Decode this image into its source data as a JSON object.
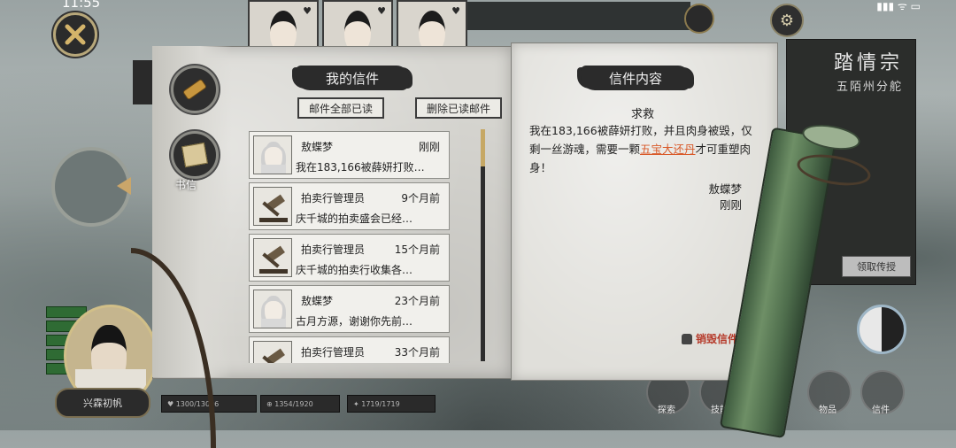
{
  "status_bar": {
    "time": "11:55",
    "right_indicators": "▮▮▮ ᯤ ▭"
  },
  "top_bar": {
    "portraits": [
      {
        "heart": "♥"
      },
      {
        "heart": "♥"
      },
      {
        "heart": "♥"
      }
    ]
  },
  "background_panel": {
    "title": "踏情宗",
    "subtitle": "五陌州分舵",
    "claim_button": "领取传授"
  },
  "character": {
    "name_button": "兴霖初帆"
  },
  "stats": [
    {
      "label": "♥ 1300/13006"
    },
    {
      "label": "⊕ 1354/1920"
    },
    {
      "label": "✦ 1719/1719"
    }
  ],
  "bottom_nav": [
    {
      "label": "探索"
    },
    {
      "label": "技能"
    },
    {
      "label": "物品"
    },
    {
      "label": "信件"
    }
  ],
  "side_tabs": {
    "mail_label": "书信"
  },
  "mailbox": {
    "title": "我的信件",
    "read_all_button": "邮件全部已读",
    "delete_read_button": "删除已读邮件",
    "items": [
      {
        "avatar": "lady",
        "sender": "敖蝶梦",
        "time": "刚刚",
        "preview": "我在183,166被薛妍打败…"
      },
      {
        "avatar": "gavel",
        "sender": "拍卖行管理员",
        "time": "9个月前",
        "preview": "庆千城的拍卖盛会已经…"
      },
      {
        "avatar": "gavel",
        "sender": "拍卖行管理员",
        "time": "15个月前",
        "preview": "庆千城的拍卖行收集各…"
      },
      {
        "avatar": "lady",
        "sender": "敖蝶梦",
        "time": "23个月前",
        "preview": "古月方源，谢谢你先前…"
      },
      {
        "avatar": "gavel",
        "sender": "拍卖行管理员",
        "time": "33个月前",
        "preview": ""
      }
    ]
  },
  "letter": {
    "title": "信件内容",
    "subject": "求救",
    "body_before": "我在183,166被薛妍打败，并且肉身被毁，仅剩一丝游魂，需要一颗",
    "body_highlight": "五宝大还丹",
    "body_after": "才可重塑肉身！",
    "sender": "敖蝶梦",
    "time": "刚刚",
    "destroy_button": "销毁信件"
  },
  "colors": {
    "highlight": "#d95a2a",
    "destroy": "#b53a2a",
    "ink": "#2b2b2b",
    "paper": "#e0dfda",
    "scroll_thumb": "#c6a865"
  }
}
